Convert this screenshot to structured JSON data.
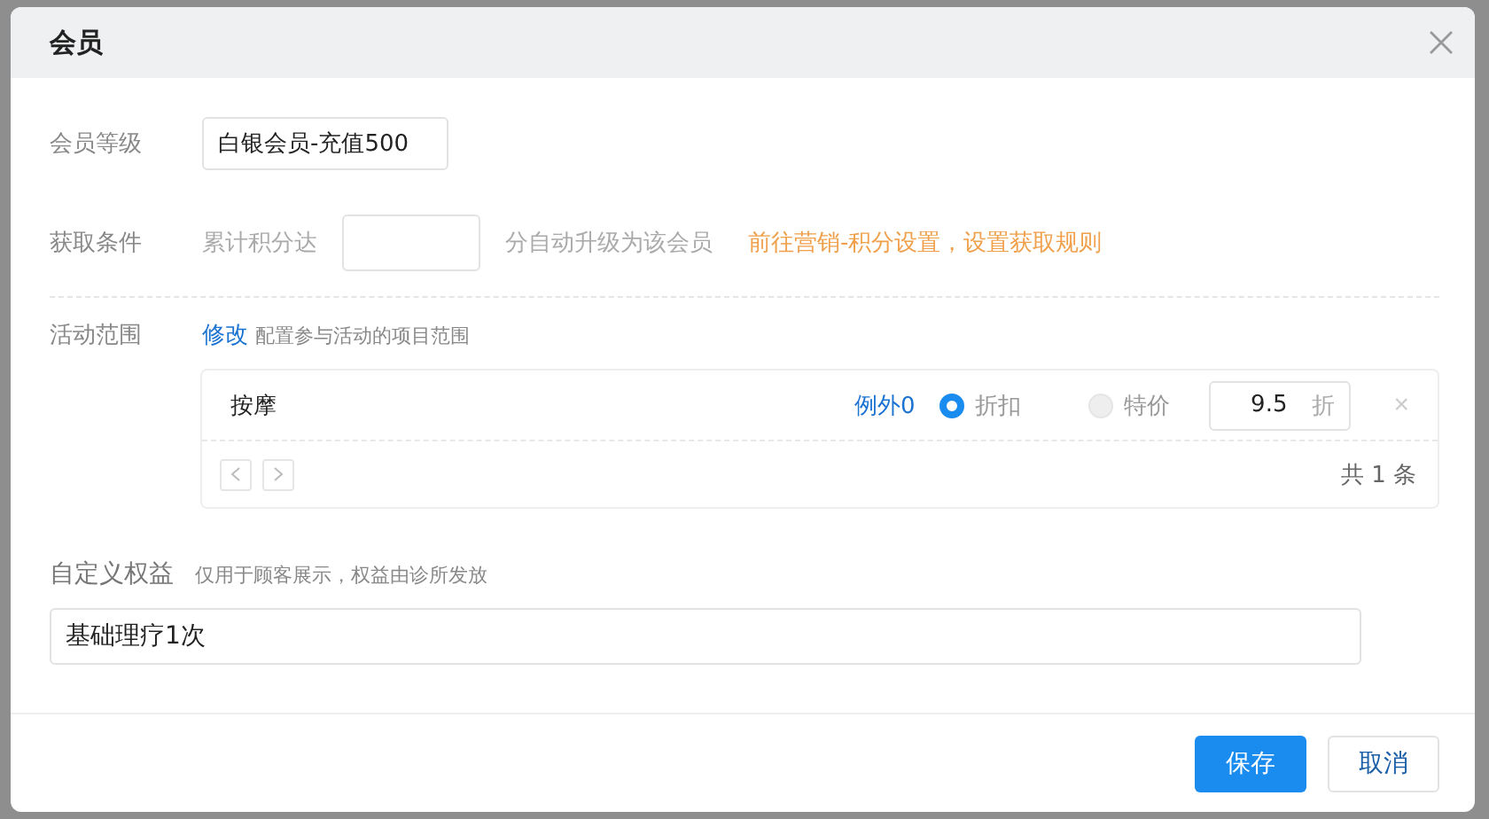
{
  "dialog": {
    "title": "会员"
  },
  "level": {
    "label": "会员等级",
    "value": "白银会员-充值500"
  },
  "condition": {
    "label": "获取条件",
    "prefix": "累计积分达",
    "suffix": "分自动升级为该会员",
    "link": "前往营销-积分设置，设置获取规则"
  },
  "scope": {
    "label": "活动范围",
    "edit_link": "修改",
    "hint": "配置参与活动的项目范围",
    "rows": [
      {
        "name": "按摩",
        "exceptions": "例外0",
        "options": [
          {
            "label": "折扣",
            "selected": true,
            "disabled": false
          },
          {
            "label": "特价",
            "selected": false,
            "disabled": true
          }
        ],
        "value": "9.5",
        "unit": "折",
        "remove": "×"
      }
    ],
    "total": "共 1 条"
  },
  "benefits": {
    "label": "自定义权益",
    "hint": "仅用于顾客展示，权益由诊所发放",
    "value": "基础理疗1次"
  },
  "buttons": [
    {
      "label": "保存",
      "kind": "primary"
    },
    {
      "label": "取消",
      "kind": "default"
    }
  ]
}
